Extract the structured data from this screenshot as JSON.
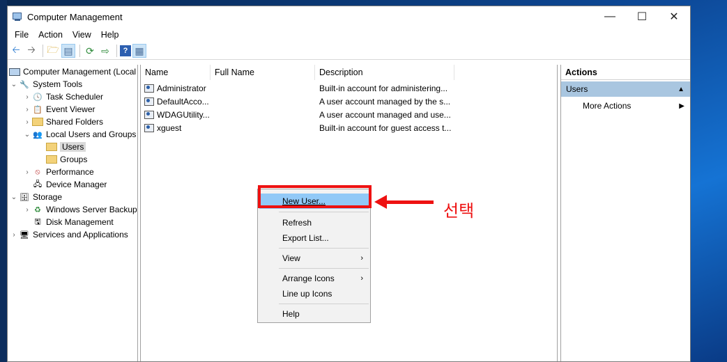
{
  "window": {
    "title": "Computer Management"
  },
  "menubar": [
    "File",
    "Action",
    "View",
    "Help"
  ],
  "tree": {
    "root": "Computer Management (Local",
    "system_tools": "System Tools",
    "task_scheduler": "Task Scheduler",
    "event_viewer": "Event Viewer",
    "shared_folders": "Shared Folders",
    "local_users": "Local Users and Groups",
    "users": "Users",
    "groups": "Groups",
    "performance": "Performance",
    "device_manager": "Device Manager",
    "storage": "Storage",
    "wsb": "Windows Server Backup",
    "disk_mgmt": "Disk Management",
    "services": "Services and Applications"
  },
  "list": {
    "columns": [
      "Name",
      "Full Name",
      "Description"
    ],
    "rows": [
      {
        "name": "Administrator",
        "full": "",
        "desc": "Built-in account for administering..."
      },
      {
        "name": "DefaultAcco...",
        "full": "",
        "desc": "A user account managed by the s..."
      },
      {
        "name": "WDAGUtility...",
        "full": "",
        "desc": "A user account managed and use..."
      },
      {
        "name": "xguest",
        "full": "",
        "desc": "Built-in account for guest access t..."
      }
    ]
  },
  "context_menu": {
    "new_user": "New User...",
    "refresh": "Refresh",
    "export": "Export List...",
    "view": "View",
    "arrange": "Arrange Icons",
    "lineup": "Line up Icons",
    "help": "Help"
  },
  "annotation": {
    "label": "선택",
    "color": "#ee1111"
  },
  "actions": {
    "title": "Actions",
    "section": "Users",
    "more": "More Actions"
  }
}
